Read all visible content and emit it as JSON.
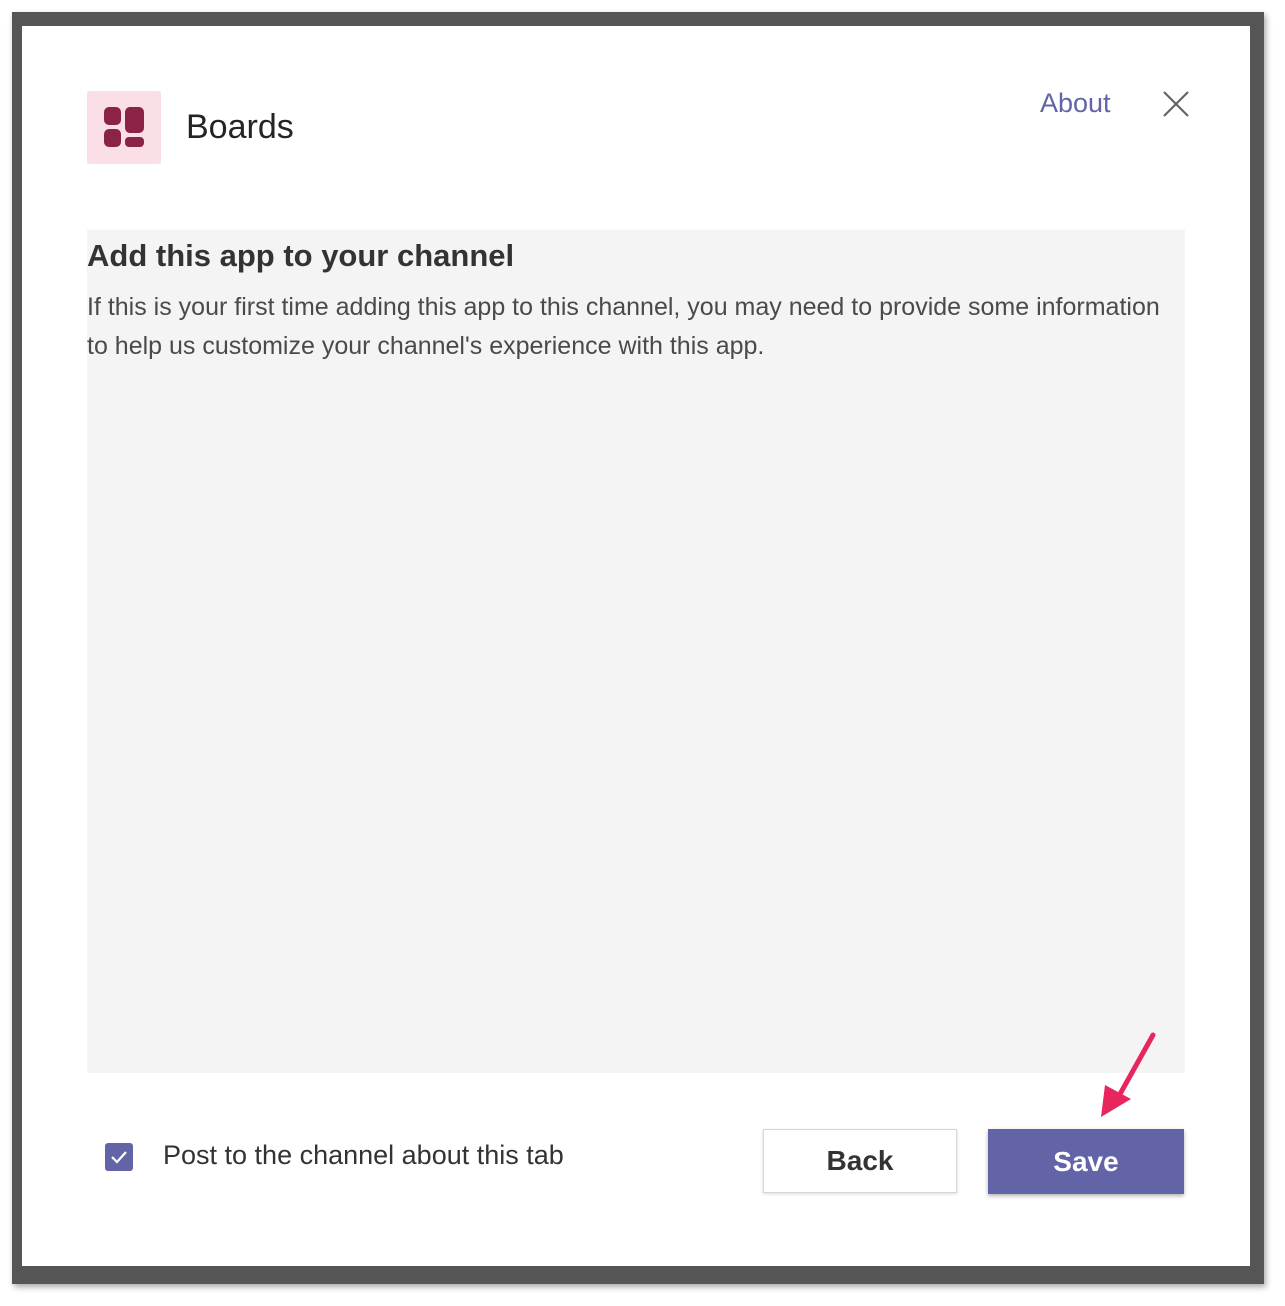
{
  "dialog": {
    "app_icon": "boards-app-icon",
    "app_title": "Boards",
    "about_link": "About",
    "close_icon": "close-icon"
  },
  "content": {
    "heading": "Add this app to your channel",
    "description": "If this is your first time adding this app to this channel, you may need to provide some information to help us customize your channel's experience with this app."
  },
  "footer": {
    "post_checkbox_checked": true,
    "post_label": "Post to the channel about this tab",
    "back_label": "Back",
    "save_label": "Save"
  },
  "colors": {
    "accent": "#6264a7",
    "app_icon_bg": "#fbdfe6",
    "app_icon_fg": "#8b2346",
    "annotation_arrow": "#e8265e"
  }
}
